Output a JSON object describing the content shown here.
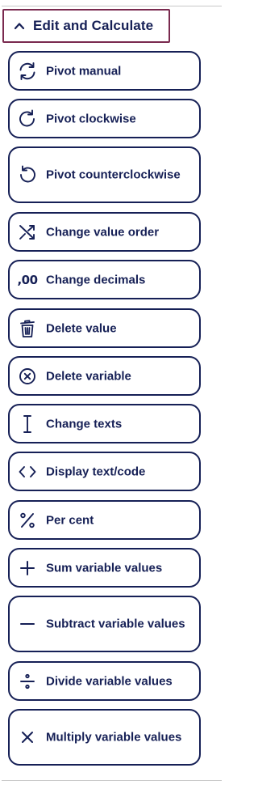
{
  "section": {
    "title": "Edit and Calculate",
    "icon": "chevron-up-icon"
  },
  "colors": {
    "text": "#162056",
    "header_border": "#7a2a4f",
    "rule": "#c8c8c8"
  },
  "buttons": [
    {
      "id": "pivot-manual",
      "label": "Pivot manual",
      "icon": "rotate-arrows-icon"
    },
    {
      "id": "pivot-clockwise",
      "label": "Pivot clockwise",
      "icon": "rotate-clockwise-icon"
    },
    {
      "id": "pivot-counterclockwise",
      "label": "Pivot counterclockwise",
      "icon": "rotate-counterclockwise-icon"
    },
    {
      "id": "change-value-order",
      "label": "Change value order",
      "icon": "shuffle-icon"
    },
    {
      "id": "change-decimals",
      "label": "Change decimals",
      "icon": "decimals-icon",
      "icon_text": ",00"
    },
    {
      "id": "delete-value",
      "label": "Delete value",
      "icon": "trash-icon"
    },
    {
      "id": "delete-variable",
      "label": "Delete variable",
      "icon": "circle-x-icon"
    },
    {
      "id": "change-texts",
      "label": "Change texts",
      "icon": "text-cursor-icon"
    },
    {
      "id": "display-text-code",
      "label": "Display text/code",
      "icon": "code-brackets-icon"
    },
    {
      "id": "per-cent",
      "label": "Per cent",
      "icon": "percent-icon"
    },
    {
      "id": "sum-variable-values",
      "label": "Sum variable values",
      "icon": "plus-icon"
    },
    {
      "id": "subtract-variable-values",
      "label": "Subtract variable values",
      "icon": "minus-icon"
    },
    {
      "id": "divide-variable-values",
      "label": "Divide variable values",
      "icon": "divide-icon"
    },
    {
      "id": "multiply-variable-values",
      "label": "Multiply variable values",
      "icon": "multiply-icon"
    }
  ]
}
